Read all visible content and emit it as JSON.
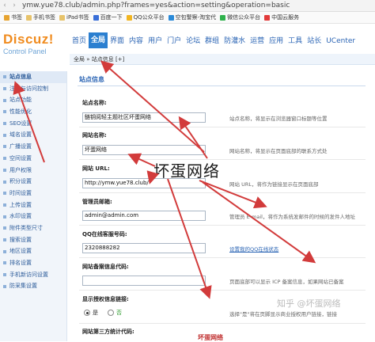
{
  "browser": {
    "url": "ymw.yue78.club/admin.php?frames=yes&action=setting&operation=basic"
  },
  "bookmarks": [
    {
      "label": "书签",
      "icon": "bookmark-star-icon",
      "color": "#e7a431"
    },
    {
      "label": "手机书签",
      "icon": "folder-icon",
      "color": "#e7c36b"
    },
    {
      "label": "iPad书签",
      "icon": "folder-icon",
      "color": "#e7c36b"
    },
    {
      "label": "百度一下",
      "icon": "paw-icon",
      "color": "#3a6fd8"
    },
    {
      "label": "QQ公众平台",
      "icon": "qq-icon",
      "color": "#f1b521"
    },
    {
      "label": "空包警察-淘宝代",
      "icon": "globe-icon",
      "color": "#2a8ad8"
    },
    {
      "label": "微信公众平台",
      "icon": "wechat-icon",
      "color": "#2fb24c"
    },
    {
      "label": "中国云服务",
      "icon": "cloud-icon",
      "color": "#e23a3a"
    }
  ],
  "logo": {
    "title": "Discuz!",
    "subtitle": "Control Panel"
  },
  "nav_tabs": [
    "首页",
    "全局",
    "界面",
    "内容",
    "用户",
    "门户",
    "论坛",
    "群组",
    "防灌水",
    "运营",
    "应用",
    "工具",
    "站长",
    "UCenter"
  ],
  "breadcrumb": "全局 » 站点信息 [+]",
  "sidebar": [
    "站点信息",
    "注册与访问控制",
    "站点功能",
    "性能优化",
    "SEO设置",
    "域名设置",
    "广播设置",
    "空间设置",
    "用户权限",
    "积分设置",
    "时间设置",
    "上传设置",
    "水印设置",
    "附件类型尺寸",
    "搜索设置",
    "地区设置",
    "排名设置",
    "手机新访问设置",
    "防采集设置"
  ],
  "section_title": "站点信息",
  "fields": [
    {
      "label": "站点名称:",
      "value": "鲢钥阅轻主题社区坏蛋网络",
      "desc": "站点名称，将显示在浏览器窗口标题等位置"
    },
    {
      "label": "网站名称:",
      "value": "坏蛋网络",
      "desc": "网站名称，将显示在页面底部的联系方式处"
    },
    {
      "label": "网站 URL:",
      "value": "http://ymw.yue78.club/",
      "desc": "网站 URL，将作为链接显示在页面底部"
    },
    {
      "label": "管理员邮箱:",
      "value": "admin@admin.com",
      "desc": "管理员 E-mail，将作为系统发邮件的时候的发件人地址"
    },
    {
      "label": "QQ在线客服号码:",
      "value": "2320888282",
      "desc": "设置我的QQ在线状态"
    },
    {
      "label": "网站备案信息代码:",
      "value": "",
      "desc": "页面底部可以显示 ICP 备案信息，如果网站已备案"
    },
    {
      "label": "显示授权信息链接:",
      "value": "",
      "desc": "选择\"是\"将在页脚显示商业授权用户链接，链接"
    },
    {
      "label": "网站第三方统计代码:",
      "value": "",
      "desc": ""
    }
  ],
  "radio": {
    "yes": "是",
    "no": "否",
    "selected": "yes"
  },
  "watermark_big": "坏蛋网络",
  "watermark_corner": "知乎 @坏蛋网络",
  "watermark_red": "坏蛋网络",
  "colors": {
    "accent": "#2b7fd0",
    "logo": "#f08b1e",
    "arrow": "#d23b3b"
  }
}
